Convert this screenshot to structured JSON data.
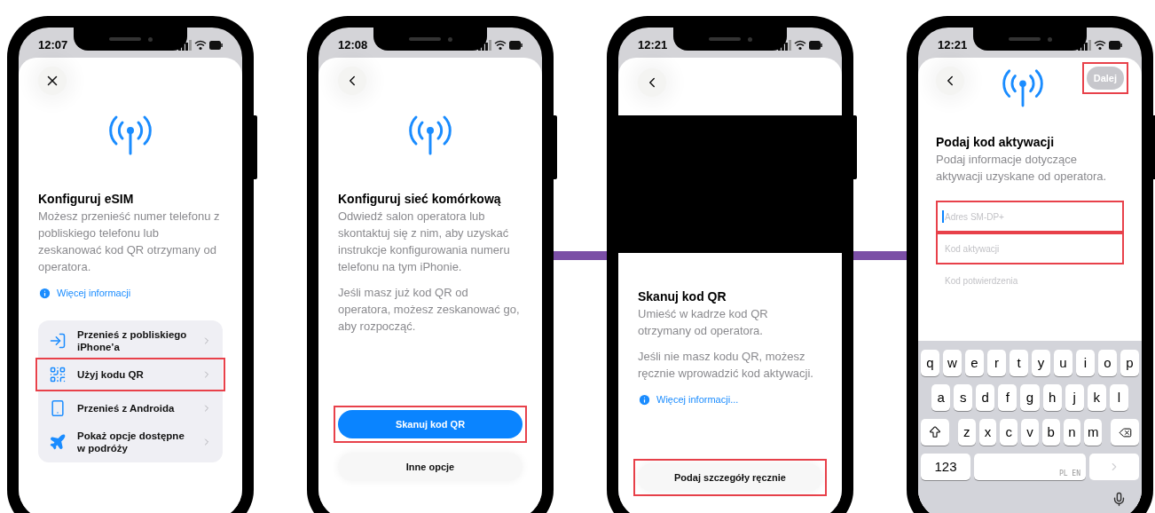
{
  "phones": [
    {
      "kind": "options",
      "time": "12:07",
      "top_button": {
        "kind": "close"
      },
      "title": "Konfiguruj eSIM",
      "paragraphs": [
        "Możesz przenieść numer telefonu z pobliskiego telefonu lub zeskanować kod QR otrzymany od operatora."
      ],
      "info_link": "Więcej informacji",
      "options": [
        {
          "kind": "transfer",
          "label": "Przenieś z pobliskiego iPhone’a",
          "highlighted": false
        },
        {
          "kind": "qr",
          "label": "Użyj kodu QR",
          "highlighted": true
        },
        {
          "kind": "phone",
          "label": "Przenieś z Androida",
          "highlighted": false
        },
        {
          "kind": "plane",
          "label": "Pokaż opcje dostępne w podróży",
          "highlighted": false
        }
      ]
    },
    {
      "kind": "info",
      "time": "12:08",
      "top_button": {
        "kind": "back"
      },
      "title": "Konfiguruj sieć komórkową",
      "paragraphs": [
        "Odwiedź salon operatora lub skontaktuj się z nim, aby uzyskać instrukcje konfigurowania numeru telefonu na tym iPhonie.",
        "Jeśli masz już kod QR od operatora, możesz zeskanować go, aby rozpocząć."
      ],
      "buttons": [
        {
          "label": "Skanuj kod QR",
          "kind": "primary",
          "highlighted": true
        },
        {
          "label": "Inne opcje",
          "kind": "secondary",
          "highlighted": false
        }
      ]
    },
    {
      "kind": "scan",
      "time": "12:21",
      "top_button": {
        "kind": "back"
      },
      "title": "Skanuj kod QR",
      "paragraphs": [
        "Umieść w kadrze kod QR otrzymany od operatora.",
        "Jeśli nie masz kodu QR, możesz ręcznie wprowadzić kod aktywacji."
      ],
      "info_link": "Więcej informacji...",
      "buttons": [
        {
          "label": "Podaj szczegóły ręcznie",
          "kind": "secondary",
          "highlighted": true
        }
      ]
    },
    {
      "kind": "form",
      "time": "12:21",
      "top_button": {
        "kind": "back"
      },
      "next_button": {
        "label": "Dalej",
        "disabled": true,
        "highlighted": true
      },
      "title": "Podaj kod aktywacji",
      "paragraphs": [
        "Podaj informacje dotyczące aktywacji uzyskane od operatora."
      ],
      "fields": [
        {
          "placeholder": "Adres SM-DP+",
          "focused": true,
          "highlighted": true
        },
        {
          "placeholder": "Kod aktywacji",
          "focused": false,
          "highlighted": true
        },
        {
          "placeholder": "Kod potwierdzenia",
          "focused": false,
          "highlighted": false
        }
      ],
      "keyboard": {
        "letter_rows": [
          [
            "q",
            "w",
            "e",
            "r",
            "t",
            "y",
            "u",
            "i",
            "o",
            "p"
          ],
          [
            "a",
            "s",
            "d",
            "f",
            "g",
            "h",
            "j",
            "k",
            "l"
          ],
          [
            "z",
            "x",
            "c",
            "v",
            "b",
            "n",
            "m"
          ]
        ],
        "numbers_key": "123",
        "space_label": "PL EN",
        "return_disabled": true
      }
    }
  ]
}
